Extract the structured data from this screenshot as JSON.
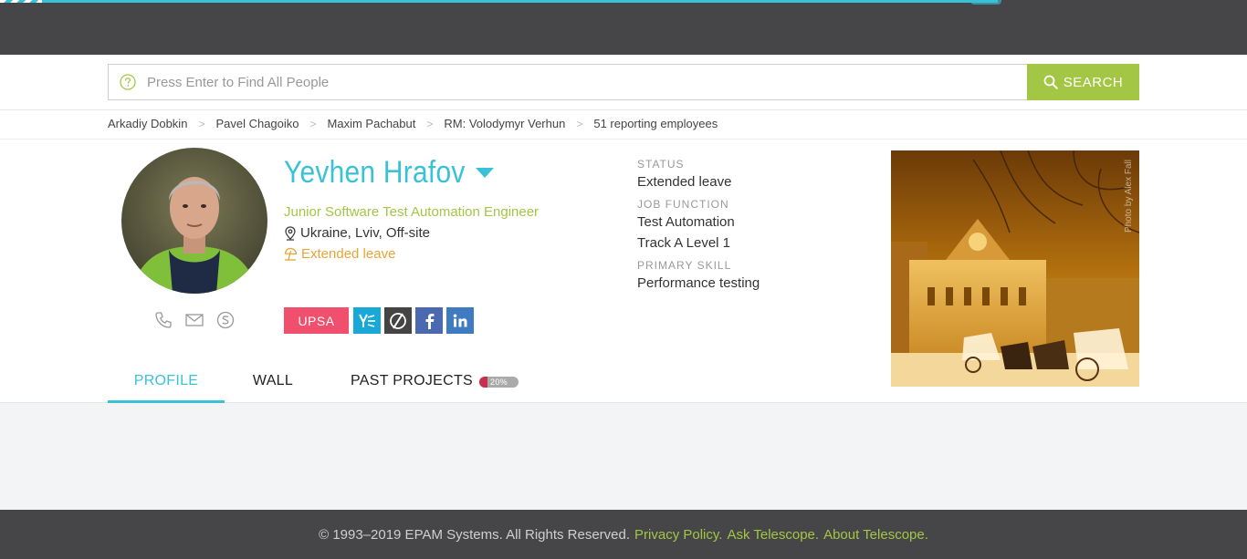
{
  "search": {
    "placeholder": "Press Enter to Find All People",
    "button_label": "SEARCH"
  },
  "breadcrumb": [
    "Arkadiy Dobkin",
    "Pavel Chagoiko",
    "Maxim Pachabut",
    "RM: Volodymyr Verhun",
    "51 reporting employees"
  ],
  "profile": {
    "name": "Yevhen Hrafov",
    "job_title": "Junior Software Test Automation Engineer",
    "location": "Ukraine, Lviv, Off-site",
    "leave_status": "Extended leave",
    "badges": {
      "upsa": "UPSA",
      "icons": [
        "yammer-icon",
        "upwork-icon",
        "facebook-icon",
        "linkedin-icon"
      ]
    },
    "contacts": [
      "phone-icon",
      "email-icon",
      "skype-icon"
    ]
  },
  "info": {
    "status_label": "STATUS",
    "status_value": "Extended leave",
    "job_function_label": "JOB FUNCTION",
    "job_function_value": "Test Automation",
    "track_value": "Track A Level 1",
    "primary_skill_label": "PRIMARY SKILL",
    "primary_skill_value": "Performance testing"
  },
  "photo": {
    "credit": "Photo by Alex Fall"
  },
  "tabs": {
    "profile": "PROFILE",
    "wall": "WALL",
    "past_projects": "PAST PROJECTS",
    "past_projects_badge": "20%",
    "past_projects_fraction": 0.2
  },
  "footer": {
    "copyright": "© 1993–2019 EPAM Systems. All Rights Reserved.",
    "privacy": "Privacy Policy.",
    "ask": "Ask Telescope.",
    "about": "About Telescope."
  },
  "colors": {
    "accent": "#39c2d7",
    "green": "#a3c644",
    "dark": "#464547",
    "leave": "#e8a435",
    "upsa": "#f0506e"
  },
  "page_load_progress": 0.8
}
